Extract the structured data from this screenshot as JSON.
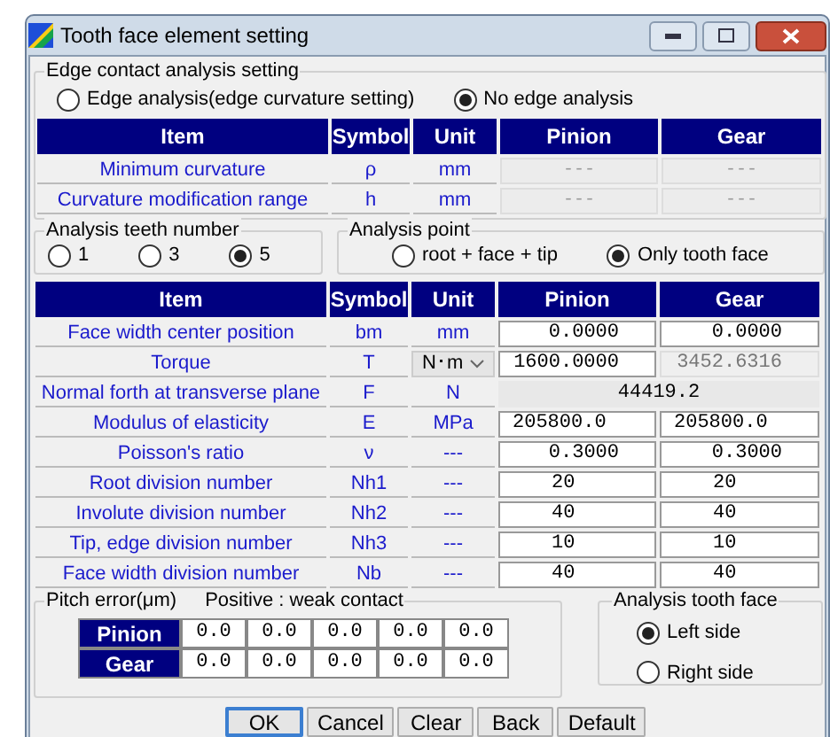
{
  "window": {
    "title": "Tooth face element setting"
  },
  "edge_contact": {
    "title": "Edge contact analysis setting",
    "options": [
      {
        "label": "Edge analysis(edge curvature setting)",
        "selected": false
      },
      {
        "label": "No edge analysis",
        "selected": true
      }
    ],
    "columns": [
      "Item",
      "Symbol",
      "Unit",
      "Pinion",
      "Gear"
    ],
    "rows": [
      {
        "item": "Minimum curvature",
        "symbol": "ρ",
        "unit": "mm",
        "pinion": "---",
        "gear": "---"
      },
      {
        "item": "Curvature modification range",
        "symbol": "h",
        "unit": "mm",
        "pinion": "---",
        "gear": "---"
      }
    ]
  },
  "teeth_number": {
    "title": "Analysis teeth number",
    "options": [
      {
        "label": "1",
        "selected": false
      },
      {
        "label": "3",
        "selected": false
      },
      {
        "label": "5",
        "selected": true
      }
    ]
  },
  "analysis_point": {
    "title": "Analysis point",
    "options": [
      {
        "label": "root + face + tip",
        "selected": false
      },
      {
        "label": "Only tooth face",
        "selected": true
      }
    ]
  },
  "main_table": {
    "columns": [
      "Item",
      "Symbol",
      "Unit",
      "Pinion",
      "Gear"
    ],
    "rows": [
      {
        "kind": "decimal",
        "item": "Face width center position",
        "symbol": "bm",
        "unit": "mm",
        "unit_dropdown": false,
        "pinion": "0.0000",
        "gear": "0.0000",
        "gear_readonly": false
      },
      {
        "kind": "decimal",
        "item": "Torque",
        "symbol": "T",
        "unit": "N･m",
        "unit_dropdown": true,
        "pinion": "1600.0000",
        "gear": "3452.6316",
        "gear_readonly": true
      },
      {
        "kind": "merged",
        "item": "Normal forth at transverse plane",
        "symbol": "F",
        "unit": "N",
        "unit_dropdown": false,
        "value": "44419.2"
      },
      {
        "kind": "modulus",
        "item": "Modulus of elasticity",
        "symbol": "E",
        "unit": "MPa",
        "unit_dropdown": false,
        "pinion": "205800.0",
        "gear": "205800.0",
        "gear_readonly": false
      },
      {
        "kind": "decimal",
        "item": "Poisson's ratio",
        "symbol": "ν",
        "unit": "---",
        "unit_dropdown": false,
        "pinion": "0.3000",
        "gear": "0.3000",
        "gear_readonly": false
      },
      {
        "kind": "count",
        "item": "Root division number",
        "symbol": "Nh1",
        "unit": "---",
        "unit_dropdown": false,
        "pinion": "20",
        "gear": "20",
        "gear_readonly": false
      },
      {
        "kind": "count",
        "item": "Involute division number",
        "symbol": "Nh2",
        "unit": "---",
        "unit_dropdown": false,
        "pinion": "40",
        "gear": "40",
        "gear_readonly": false
      },
      {
        "kind": "count",
        "item": "Tip, edge division number",
        "symbol": "Nh3",
        "unit": "---",
        "unit_dropdown": false,
        "pinion": "10",
        "gear": "10",
        "gear_readonly": false
      },
      {
        "kind": "count",
        "item": "Face width division number",
        "symbol": "Nb",
        "unit": "---",
        "unit_dropdown": false,
        "pinion": "40",
        "gear": "40",
        "gear_readonly": false
      }
    ]
  },
  "pitch_error": {
    "title": "Pitch error(μm)",
    "note": "Positive : weak contact",
    "rows": [
      {
        "label": "Pinion",
        "values": [
          "0.0",
          "0.0",
          "0.0",
          "0.0",
          "0.0"
        ]
      },
      {
        "label": "Gear",
        "values": [
          "0.0",
          "0.0",
          "0.0",
          "0.0",
          "0.0"
        ]
      }
    ]
  },
  "tooth_face": {
    "title": "Analysis tooth face",
    "options": [
      {
        "label": "Left side",
        "selected": true
      },
      {
        "label": "Right side",
        "selected": false
      }
    ]
  },
  "buttons": [
    {
      "label": "OK",
      "default": true
    },
    {
      "label": "Cancel",
      "default": false
    },
    {
      "label": "Clear",
      "default": false
    },
    {
      "label": "Back",
      "default": false
    },
    {
      "label": "Default",
      "default": false
    }
  ]
}
